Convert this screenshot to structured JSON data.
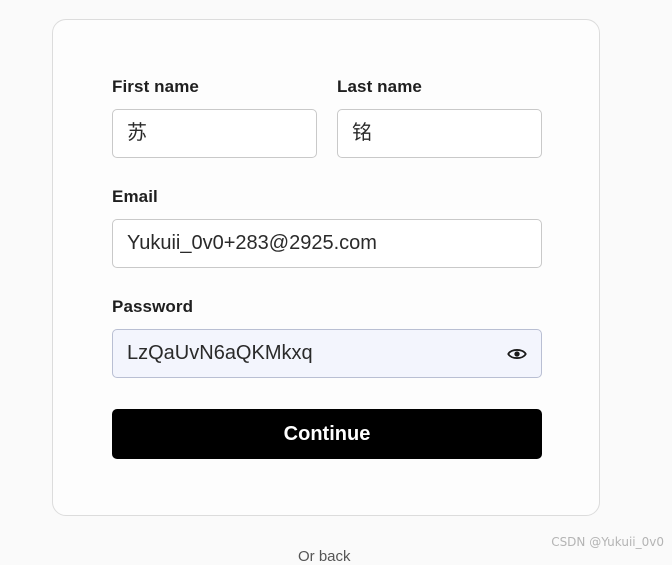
{
  "form": {
    "first_name_label": "First name",
    "first_name_value": "苏",
    "last_name_label": "Last name",
    "last_name_value": "铭",
    "email_label": "Email",
    "email_value": "Yukuii_0v0+283@2925.com",
    "password_label": "Password",
    "password_value": "LzQaUvN6aQKMkxq",
    "password_toggle_icon": "eye-icon",
    "continue_label": "Continue"
  },
  "footer": {
    "partial_text": "Or back"
  },
  "watermark": "CSDN @Yukuii_0v0",
  "colors": {
    "button_bg": "#000000",
    "button_text": "#ffffff",
    "password_field_bg": "#f3f5fd"
  }
}
